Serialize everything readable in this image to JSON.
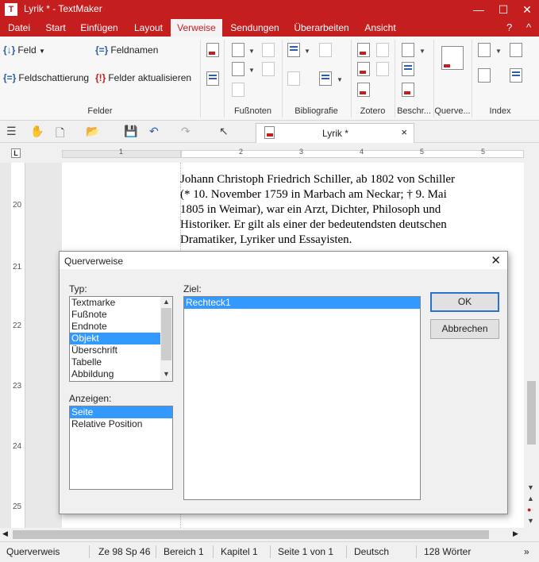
{
  "window": {
    "title": "Lyrik * - TextMaker",
    "app_icon": "T",
    "minimize": "—",
    "maximize": "☐",
    "close": "✕"
  },
  "menu": {
    "tabs": [
      "Datei",
      "Start",
      "Einfügen",
      "Layout",
      "Verweise",
      "Sendungen",
      "Überarbeiten",
      "Ansicht"
    ],
    "active_index": 4,
    "help": "?",
    "collapse": "^"
  },
  "ribbon": {
    "feld": "Feld",
    "feldnamen": "Feldnamen",
    "feldschattierung": "Feldschattierung",
    "felder_aktualisieren": "Felder aktualisieren",
    "feld_icon": "{↓}",
    "feldnamen_icon": "{=}",
    "feldschattierung_icon": "{=}",
    "aktualisieren_icon": "{!}",
    "groups": [
      "Felder",
      "Fußnoten",
      "Bibliografie",
      "Zotero",
      "Beschr...",
      "Querve...",
      "Index"
    ]
  },
  "toolbar": {
    "doc_tab_label": "Lyrik *",
    "doc_tab_close": "×"
  },
  "ruler": {
    "numbers": [
      "1",
      "2",
      "3",
      "4",
      "5"
    ],
    "corner": "L"
  },
  "vruler": {
    "numbers": [
      "20",
      "21",
      "22",
      "23",
      "24",
      "25"
    ]
  },
  "document": {
    "lines": [
      "Johann Christoph Friedrich Schiller, ab 1802 von Schiller",
      "(* 10. November 1759 in Marbach am Neckar; † 9. Mai",
      "1805 in Weimar), war ein Arzt, Dichter, Philosoph und",
      "Historiker. Er gilt als einer der bedeutendsten deutschen",
      "Dramatiker, Lyriker und Essayisten."
    ]
  },
  "dialog": {
    "title": "Querverweise",
    "close": "✕",
    "typ_label": "Typ:",
    "typ_items": [
      "Textmarke",
      "Fußnote",
      "Endnote",
      "Objekt",
      "Überschrift",
      "Tabelle",
      "Abbildung"
    ],
    "typ_selected": 3,
    "ziel_label": "Ziel:",
    "ziel_items": [
      "Rechteck1"
    ],
    "ziel_selected": 0,
    "anzeigen_label": "Anzeigen:",
    "anzeigen_items": [
      "Seite",
      "Relative Position"
    ],
    "anzeigen_selected": 0,
    "ok_label": "OK",
    "cancel_label": "Abbrechen"
  },
  "status": {
    "mode": "Querverweis",
    "position": "Ze 98 Sp 46",
    "bereich": "Bereich 1",
    "kapitel": "Kapitel 1",
    "seite": "Seite 1 von 1",
    "sprache": "Deutsch",
    "woerter": "128 Wörter",
    "more": "»"
  },
  "colors": {
    "brand": "#c41e1e",
    "selection": "#3399ff",
    "accent": "#2a5ea8"
  }
}
